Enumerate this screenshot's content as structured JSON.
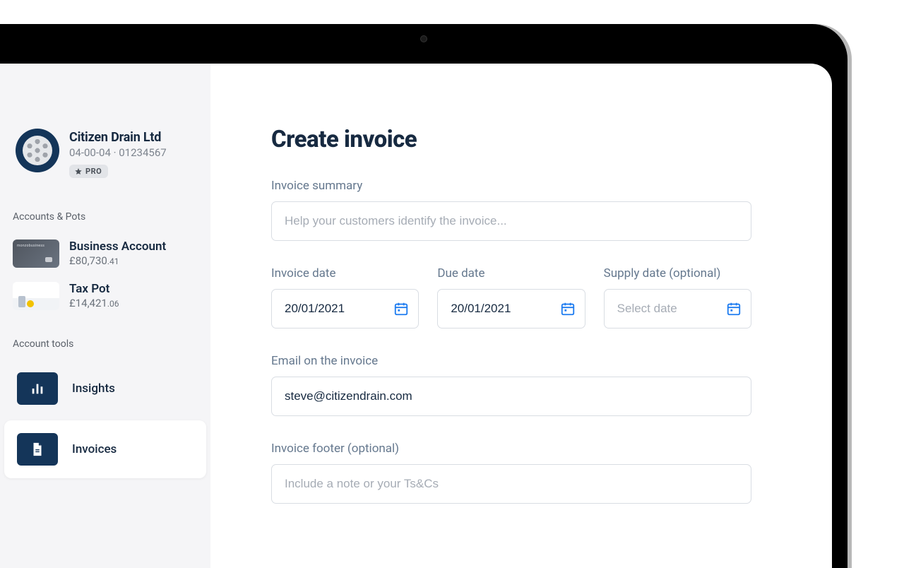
{
  "company": {
    "name": "Citizen Drain Ltd",
    "sortCode": "04-00-04",
    "accountNumber": "01234567",
    "badge": "PRO"
  },
  "sidebar": {
    "accountsSectionLabel": "Accounts & Pots",
    "toolsSectionLabel": "Account tools",
    "accounts": [
      {
        "name": "Business Account",
        "balanceMain": "£80,730",
        "balanceCents": ".41",
        "cardBrand": "monzobusiness"
      },
      {
        "name": "Tax Pot",
        "balanceMain": "£14,421",
        "balanceCents": ".06"
      }
    ],
    "tools": [
      {
        "label": "Insights"
      },
      {
        "label": "Invoices"
      }
    ]
  },
  "main": {
    "title": "Create invoice",
    "summary": {
      "label": "Invoice summary",
      "placeholder": "Help your customers identify the invoice...",
      "value": ""
    },
    "dates": {
      "invoice": {
        "label": "Invoice date",
        "value": "20/01/2021"
      },
      "due": {
        "label": "Due date",
        "value": "20/01/2021"
      },
      "supply": {
        "label": "Supply date (optional)",
        "placeholder": "Select date",
        "value": ""
      }
    },
    "email": {
      "label": "Email on the invoice",
      "value": "steve@citizendrain.com"
    },
    "footer": {
      "label": "Invoice footer (optional)",
      "placeholder": "Include a note or your Ts&Cs",
      "value": ""
    }
  }
}
